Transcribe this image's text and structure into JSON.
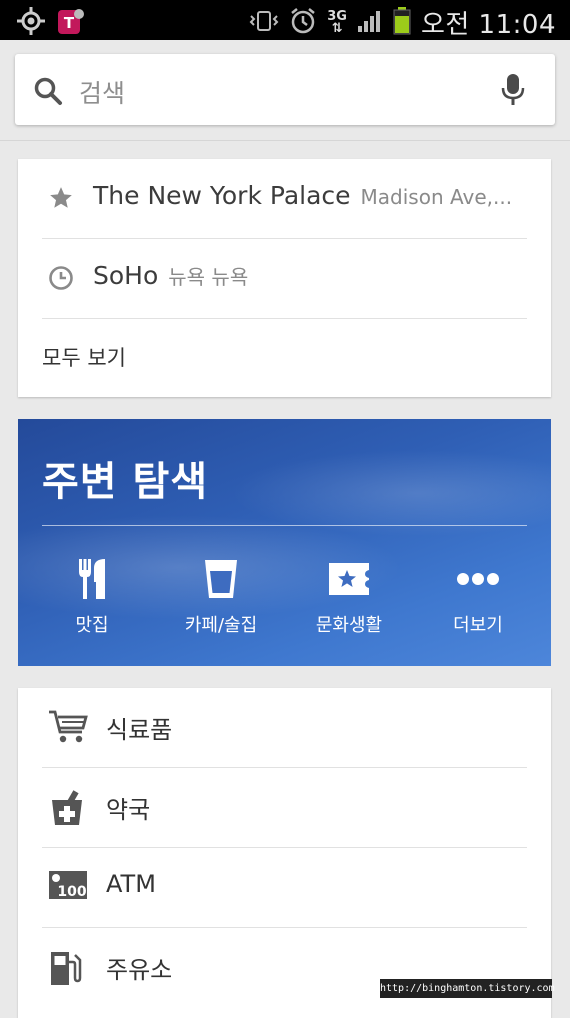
{
  "status_bar": {
    "network": "3G",
    "time": "오전 11:04"
  },
  "search": {
    "placeholder": "검색"
  },
  "recent": {
    "items": [
      {
        "title": "The New York Palace",
        "subtitle": "Madison Ave,...",
        "icon": "star-icon"
      },
      {
        "title": "SoHo",
        "subtitle": "뉴욕 뉴욕",
        "icon": "clock-icon"
      }
    ],
    "see_all": "모두 보기"
  },
  "explore": {
    "title": "주변 탐색",
    "categories": [
      {
        "label": "맛집",
        "icon": "fork-knife-icon"
      },
      {
        "label": "카페/술집",
        "icon": "cup-icon"
      },
      {
        "label": "문화생활",
        "icon": "ticket-icon"
      },
      {
        "label": "더보기",
        "icon": "more-dots-icon"
      }
    ]
  },
  "places": [
    {
      "label": "식료품",
      "icon": "cart-icon"
    },
    {
      "label": "약국",
      "icon": "pharmacy-icon"
    },
    {
      "label": "ATM",
      "icon": "atm-icon"
    },
    {
      "label": "주유소",
      "icon": "gas-station-icon"
    }
  ],
  "watermark": "http://binghamton.tistory.com",
  "colors": {
    "status_bar": "#000000",
    "background": "#e9e9e9",
    "explore_blue": "#2f5fb5",
    "icon_gray": "#555555"
  }
}
